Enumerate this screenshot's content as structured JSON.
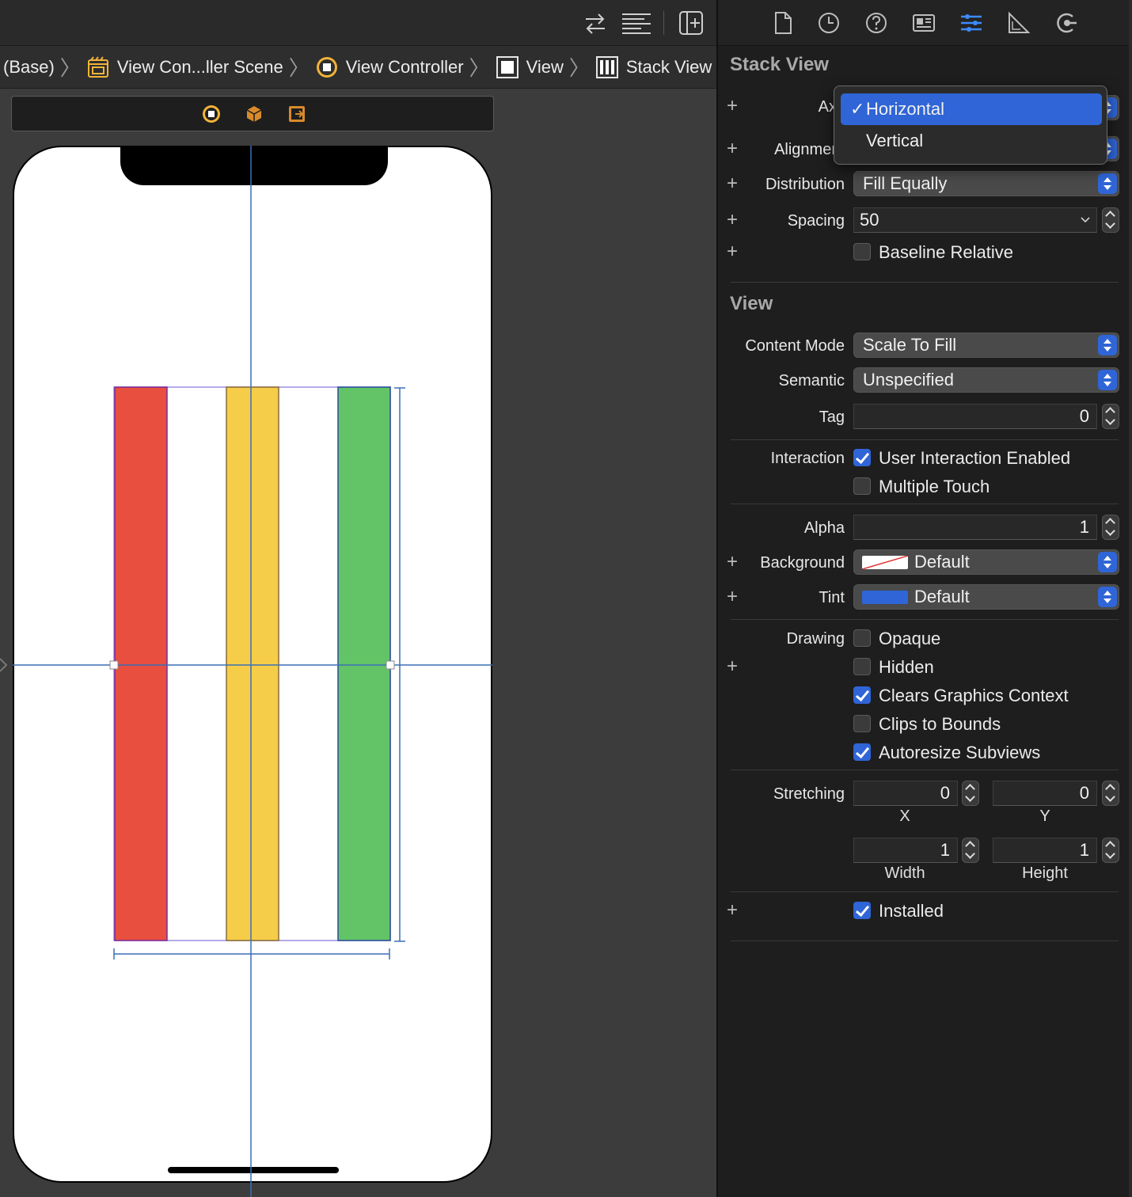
{
  "breadcrumb": {
    "items": [
      "(Base)",
      "View Con...ller Scene",
      "View Controller",
      "View",
      "Stack View"
    ]
  },
  "canvas": {
    "colors": {
      "red": "#e94f3f",
      "yellow": "#f6cd48",
      "green": "#62c466",
      "guide": "#3c6fb5"
    },
    "arranged_subviews": [
      "red-view",
      "yellow-view",
      "green-view"
    ]
  },
  "inspector": {
    "stack_view": {
      "title": "Stack View",
      "axis_label": "Ax",
      "alignment_label": "Alignmer",
      "distribution_label": "Distribution",
      "distribution_value": "Fill Equally",
      "spacing_label": "Spacing",
      "spacing_value": "50",
      "baseline_label": "Baseline Relative",
      "baseline_checked": false
    },
    "axis_menu": {
      "options": [
        {
          "label": "Horizontal",
          "selected": true
        },
        {
          "label": "Vertical",
          "selected": false
        }
      ],
      "check_glyph": "✓"
    },
    "view": {
      "title": "View",
      "content_mode_label": "Content Mode",
      "content_mode_value": "Scale To Fill",
      "semantic_label": "Semantic",
      "semantic_value": "Unspecified",
      "tag_label": "Tag",
      "tag_value": "0",
      "interaction_label": "Interaction",
      "user_interaction_label": "User Interaction Enabled",
      "user_interaction_checked": true,
      "multiple_touch_label": "Multiple Touch",
      "multiple_touch_checked": false,
      "alpha_label": "Alpha",
      "alpha_value": "1",
      "background_label": "Background",
      "background_value": "Default",
      "tint_label": "Tint",
      "tint_value": "Default",
      "tint_color": "#2f65d6",
      "drawing_label": "Drawing",
      "opaque_label": "Opaque",
      "opaque_checked": false,
      "hidden_label": "Hidden",
      "hidden_checked": false,
      "clears_label": "Clears Graphics Context",
      "clears_checked": true,
      "clips_label": "Clips to Bounds",
      "clips_checked": false,
      "autoresize_label": "Autoresize Subviews",
      "autoresize_checked": true,
      "stretching_label": "Stretching",
      "stretch_x": "0",
      "stretch_y": "0",
      "stretch_w": "1",
      "stretch_h": "1",
      "x_label": "X",
      "y_label": "Y",
      "width_label": "Width",
      "height_label": "Height",
      "installed_label": "Installed",
      "installed_checked": true
    }
  },
  "plus_glyph": "+"
}
